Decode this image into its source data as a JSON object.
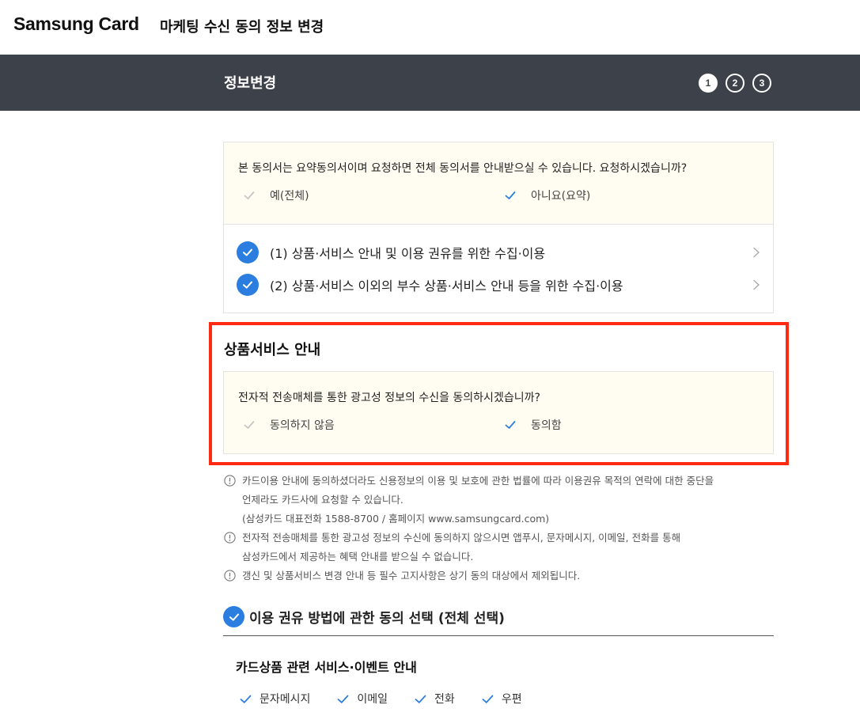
{
  "header": {
    "logo": "Samsung Card",
    "title": "마케팅 수신 동의 정보 변경"
  },
  "stepbar": {
    "title": "정보변경",
    "steps": [
      "1",
      "2",
      "3"
    ],
    "active_step": "1"
  },
  "summary": {
    "question": "본 동의서는 요약동의서이며 요청하면 전체 동의서를 안내받으실 수 있습니다. 요청하시겠습니까?",
    "options": [
      {
        "label": "예(전체)",
        "selected": false
      },
      {
        "label": "아니요(요약)",
        "selected": true
      }
    ]
  },
  "consents": [
    {
      "label": "(1) 상품·서비스 안내 및 이용 권유를 위한 수집·이용",
      "checked": true
    },
    {
      "label": "(2) 상품·서비스 이외의 부수 상품·서비스 안내 등을 위한 수집·이용",
      "checked": true
    }
  ],
  "product_service": {
    "title": "상품서비스 안내",
    "question": "전자적 전송매체를 통한 광고성 정보의 수신을 동의하시겠습니까?",
    "options": [
      {
        "label": "동의하지 않음",
        "selected": false
      },
      {
        "label": "동의함",
        "selected": true
      }
    ]
  },
  "notes": {
    "n1_line1": "카드이용 안내에 동의하셨더라도 신용정보의 이용 및 보호에 관한 법률에 따라 이용권유 목적의 연락에 대한 중단을",
    "n1_line2": "언제라도 카드사에 요청할 수 있습니다.",
    "n1_line3": "(삼성카드 대표전화 1588-8700 / 홈페이지 www.samsungcard.com)",
    "n2_line1": "전자적 전송매체를 통한 광고성 정보의 수신에 동의하지 않으시면 앱푸시, 문자메시지, 이메일, 전화를 통해",
    "n2_line2": "삼성카드에서 제공하는 혜택 안내를 받으실 수 없습니다.",
    "n3_line1": "갱신 및 상품서비스 변경 안내 등 필수 고지사항은 상기 동의 대상에서 제외됩니다."
  },
  "method_section": {
    "all_select_label": "이용 권유 방법에 관한 동의 선택 (전체 선택)",
    "subtitle": "카드상품 관련 서비스·이벤트 안내",
    "methods": [
      "문자메시지",
      "이메일",
      "전화",
      "우편"
    ]
  },
  "colors": {
    "accent": "#2b7de0",
    "step_bar": "#3d4149",
    "highlight": "#ff2a12",
    "cream": "#fffdf1",
    "check_off": "#c7c7c7"
  }
}
